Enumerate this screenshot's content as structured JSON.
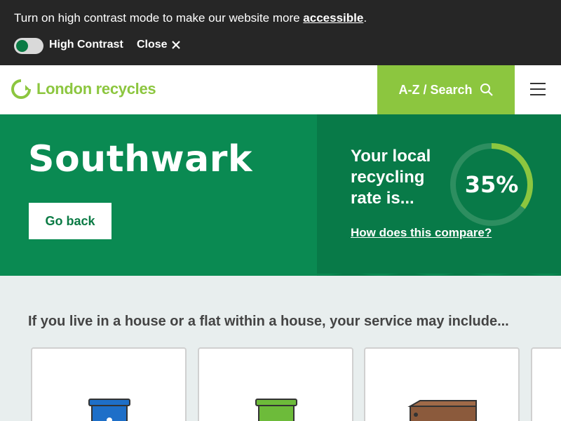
{
  "accessibility": {
    "message": "Turn on high contrast mode to make our website more ",
    "link_text": "accessible",
    "period": ".",
    "toggle_label": "High Contrast",
    "close_label": "Close"
  },
  "header": {
    "logo_text": "London recycles",
    "search_label": "A-Z / Search"
  },
  "hero": {
    "title": "Southwark",
    "back_label": "Go back",
    "rate_label": "Your local recycling rate is...",
    "rate_value": "35%",
    "rate_fraction": 0.35,
    "compare_link": "How does this compare?"
  },
  "content": {
    "heading": "If you live in a house or a flat within a house, your service may include..."
  },
  "colors": {
    "brand_green": "#8cc63f",
    "dark_green": "#0a8a52",
    "bin_blue": "#1e6fc8",
    "bin_green": "#6dbb3a",
    "bin_brown": "#8b5a3c"
  }
}
